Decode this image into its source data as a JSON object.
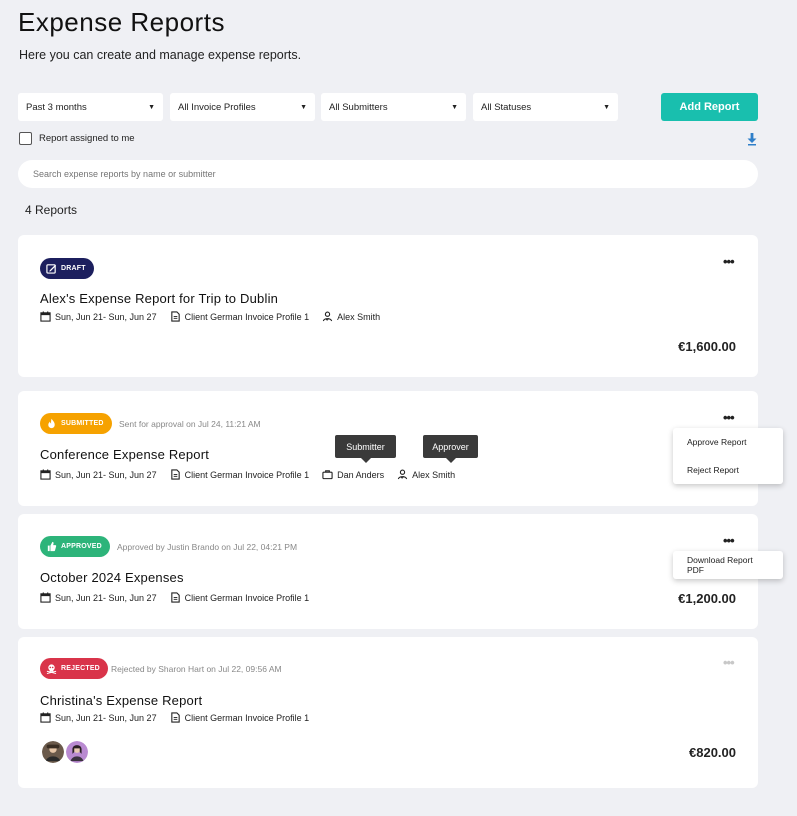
{
  "page": {
    "title": "Expense Reports",
    "subtitle": "Here you can create and manage expense reports."
  },
  "filters": {
    "period": "Past 3 months",
    "invoice_profiles": "All Invoice Profiles",
    "submitters": "All Submitters",
    "statuses": "All Statuses"
  },
  "toolbar": {
    "add_report_label": "Add Report",
    "assigned_to_me_label": "Report assigned to me"
  },
  "search": {
    "placeholder": "Search expense reports by name or submitter"
  },
  "summary": {
    "count_label": "4 Reports"
  },
  "colors": {
    "accent": "#19bfae",
    "draft": "#1c1f5e",
    "submitted": "#f6a200",
    "approved": "#2db47a",
    "rejected": "#d9344a",
    "download_icon": "#2f7fc9"
  },
  "reports": [
    {
      "status": "DRAFT",
      "status_icon": "pencil-square-icon",
      "status_note": "",
      "title": "Alex's Expense Report for Trip to Dublin",
      "dates": "Sun, Jun 21- Sun, Jun 27",
      "invoice_profile": "Client German Invoice Profile 1",
      "approver": "Alex Smith",
      "amount": "€1,600.00"
    },
    {
      "status": "SUBMITTED",
      "status_icon": "flame-icon",
      "status_note": "Sent for approval on Jul 24, 11:21 AM",
      "title": "Conference Expense Report",
      "dates": "Sun, Jun 21- Sun, Jun 27",
      "invoice_profile": "Client German Invoice Profile 1",
      "submitter": "Dan Anders",
      "approver": "Alex Smith",
      "submitter_tooltip": "Submitter",
      "approver_tooltip": "Approver",
      "menu": [
        "Approve Report",
        "Reject Report"
      ]
    },
    {
      "status": "APPROVED",
      "status_icon": "thumbs-up-icon",
      "status_note": "Approved by Justin Brando on Jul 22, 04:21 PM",
      "title": "October 2024 Expenses",
      "dates": "Sun, Jun 21- Sun, Jun 27",
      "invoice_profile": "Client German Invoice Profile 1",
      "amount": "€1,200.00",
      "menu": [
        "Download Report PDF"
      ]
    },
    {
      "status": "REJECTED",
      "status_icon": "skull-icon",
      "status_note": "Rejected by Sharon Hart on Jul 22, 09:56 AM",
      "title": "Christina's Expense Report",
      "dates": "Sun, Jun 21- Sun, Jun 27",
      "invoice_profile": "Client German Invoice Profile 1",
      "amount": "€820.00"
    }
  ]
}
